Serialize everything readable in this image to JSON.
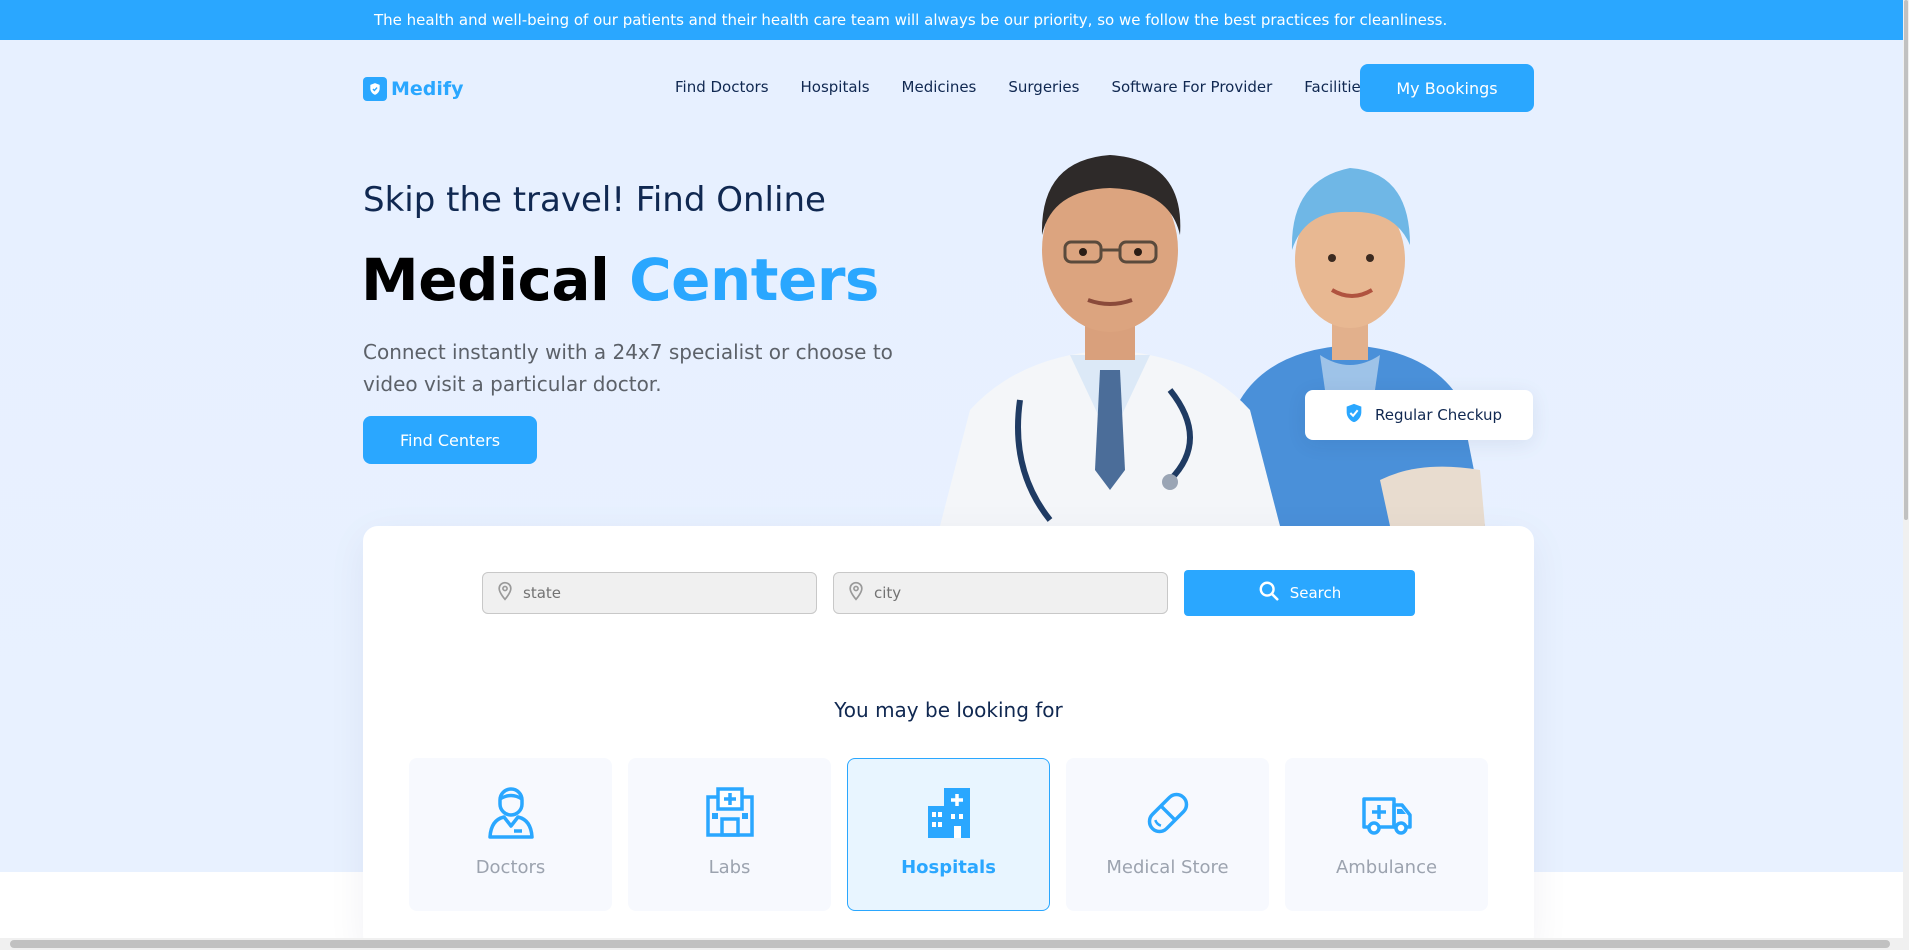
{
  "announcement": "The health and well-being of our patients and their health care team will always be our priority, so we follow the best practices for cleanliness.",
  "brand": {
    "name": "Medify",
    "color": "#2aa7ff",
    "logo_icon": "shield-check-icon"
  },
  "nav": {
    "links": [
      "Find Doctors",
      "Hospitals",
      "Medicines",
      "Surgeries",
      "Software For Provider",
      "Facilities"
    ],
    "cta": "My Bookings"
  },
  "hero": {
    "subtitle": "Skip the travel! Find Online",
    "title_main": "Medical",
    "title_accent": "Centers",
    "description": "Connect instantly with a 24x7 specialist or choose to video visit a particular doctor.",
    "cta": "Find Centers",
    "badge": "Regular Checkup",
    "badge_icon": "verified-shield-icon"
  },
  "search": {
    "state_placeholder": "state",
    "city_placeholder": "city",
    "button": "Search",
    "field_icon": "location-pin-icon",
    "button_icon": "search-icon"
  },
  "categories": {
    "heading": "You may be looking for",
    "items": [
      {
        "label": "Doctors",
        "icon": "doctor-icon",
        "active": false
      },
      {
        "label": "Labs",
        "icon": "lab-icon",
        "active": false
      },
      {
        "label": "Hospitals",
        "icon": "hospital-icon",
        "active": true
      },
      {
        "label": "Medical Store",
        "icon": "capsule-icon",
        "active": false
      },
      {
        "label": "Ambulance",
        "icon": "ambulance-icon",
        "active": false
      }
    ]
  },
  "colors": {
    "accent": "#2aa7ff",
    "navy": "#102851",
    "hero_bg": "#e7f0ff",
    "muted": "#9ca3af"
  }
}
